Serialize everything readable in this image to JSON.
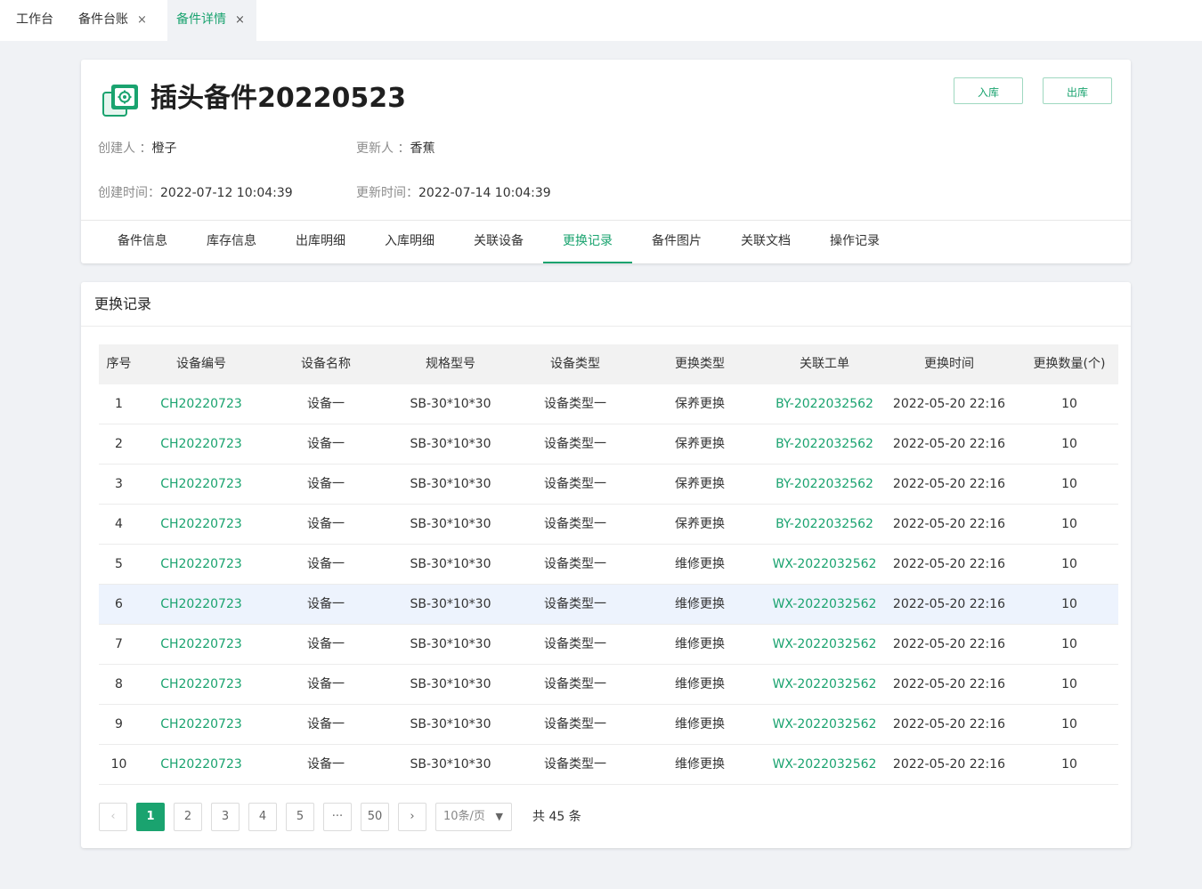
{
  "top_tabs": [
    {
      "label": "工作台",
      "closable": false,
      "active": false
    },
    {
      "label": "备件台账",
      "closable": true,
      "active": false
    },
    {
      "label": "备件详情",
      "closable": true,
      "active": true
    }
  ],
  "close_glyph": "×",
  "header": {
    "title": "插头备件20220523",
    "icon": "spare-part-gear-icon",
    "buttons": {
      "inbound": "入库",
      "outbound": "出库"
    },
    "meta": {
      "creator_label": "创建人 ：",
      "creator": "橙子",
      "updater_label": "更新人 ：",
      "updater": "香蕉",
      "created_time_label": "创建时间：",
      "created_time": "2022-07-12 10:04:39",
      "updated_time_label": "更新时间：",
      "updated_time": "2022-07-14 10:04:39"
    },
    "tabs": [
      "备件信息",
      "库存信息",
      "出库明细",
      "入库明细",
      "关联设备",
      "更换记录",
      "备件图片",
      "关联文档",
      "操作记录"
    ],
    "active_tab": "更换记录"
  },
  "record": {
    "title": "更换记录",
    "columns": [
      "序号",
      "设备编号",
      "设备名称",
      "规格型号",
      "设备类型",
      "更换类型",
      "关联工单",
      "更换时间",
      "更换数量(个)"
    ],
    "rows": [
      [
        "1",
        "CH20220723",
        "设备一",
        "SB-30*10*30",
        "设备类型一",
        "保养更换",
        "BY-2022032562",
        "2022-05-20 22:16",
        "10"
      ],
      [
        "2",
        "CH20220723",
        "设备一",
        "SB-30*10*30",
        "设备类型一",
        "保养更换",
        "BY-2022032562",
        "2022-05-20 22:16",
        "10"
      ],
      [
        "3",
        "CH20220723",
        "设备一",
        "SB-30*10*30",
        "设备类型一",
        "保养更换",
        "BY-2022032562",
        "2022-05-20 22:16",
        "10"
      ],
      [
        "4",
        "CH20220723",
        "设备一",
        "SB-30*10*30",
        "设备类型一",
        "保养更换",
        "BY-2022032562",
        "2022-05-20 22:16",
        "10"
      ],
      [
        "5",
        "CH20220723",
        "设备一",
        "SB-30*10*30",
        "设备类型一",
        "维修更换",
        "WX-2022032562",
        "2022-05-20 22:16",
        "10"
      ],
      [
        "6",
        "CH20220723",
        "设备一",
        "SB-30*10*30",
        "设备类型一",
        "维修更换",
        "WX-2022032562",
        "2022-05-20 22:16",
        "10"
      ],
      [
        "7",
        "CH20220723",
        "设备一",
        "SB-30*10*30",
        "设备类型一",
        "维修更换",
        "WX-2022032562",
        "2022-05-20 22:16",
        "10"
      ],
      [
        "8",
        "CH20220723",
        "设备一",
        "SB-30*10*30",
        "设备类型一",
        "维修更换",
        "WX-2022032562",
        "2022-05-20 22:16",
        "10"
      ],
      [
        "9",
        "CH20220723",
        "设备一",
        "SB-30*10*30",
        "设备类型一",
        "维修更换",
        "WX-2022032562",
        "2022-05-20 22:16",
        "10"
      ],
      [
        "10",
        "CH20220723",
        "设备一",
        "SB-30*10*30",
        "设备类型一",
        "维修更换",
        "WX-2022032562",
        "2022-05-20 22:16",
        "10"
      ]
    ],
    "highlighted_row": "6"
  },
  "pagination": {
    "prev": "‹",
    "next": "›",
    "pages": [
      "1",
      "2",
      "3",
      "4",
      "5"
    ],
    "ellipsis": "···",
    "last_page": "50",
    "current_page": "1",
    "page_size": "10条/页",
    "page_size_arrow": "▼",
    "total": "共 45 条"
  },
  "colors": {
    "accent": "#1aa36f",
    "page_background": "#f0f2f5",
    "highlight_row": "#edf3fd"
  }
}
